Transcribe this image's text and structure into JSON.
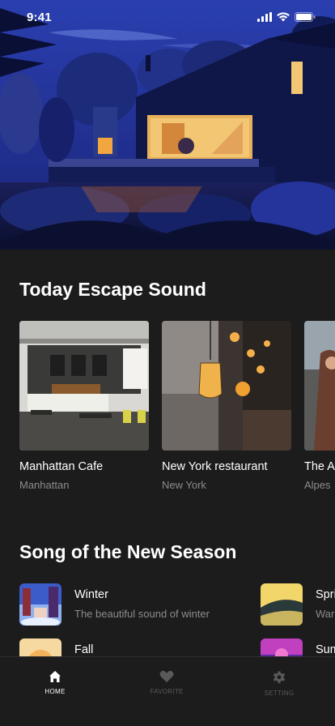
{
  "status_bar": {
    "time": "9:41",
    "icons": [
      "signal-icon",
      "wifi-icon",
      "battery-icon"
    ]
  },
  "hero": {
    "description_icon": "night-house-illustration"
  },
  "escape_section": {
    "title": "Today Escape Sound",
    "cards": [
      {
        "title": "Manhattan Cafe",
        "subtitle": "Manhattan"
      },
      {
        "title": "New York restaurant",
        "subtitle": "New York"
      },
      {
        "title": "The Alpes",
        "subtitle": "Alpes"
      }
    ]
  },
  "season_section": {
    "title": "Song of the New Season",
    "songs": [
      {
        "title": "Winter",
        "subtitle": "The beautiful sound of winter"
      },
      {
        "title": "Spring",
        "subtitle": "Warm"
      },
      {
        "title": "Fall",
        "subtitle": ""
      },
      {
        "title": "Summer",
        "subtitle": ""
      }
    ]
  },
  "tabbar": {
    "tabs": [
      {
        "label": "HOME",
        "icon": "home-icon",
        "active": true
      },
      {
        "label": "FAVORITE",
        "icon": "heart-icon",
        "active": false
      },
      {
        "label": "SETTING",
        "icon": "gear-icon",
        "active": false
      }
    ]
  },
  "colors": {
    "background": "#1c1c1c",
    "text_primary": "#ffffff",
    "text_secondary": "#8c8c8c",
    "tab_inactive": "#5a5a5a",
    "hero_sky": "#1a2a8a"
  }
}
